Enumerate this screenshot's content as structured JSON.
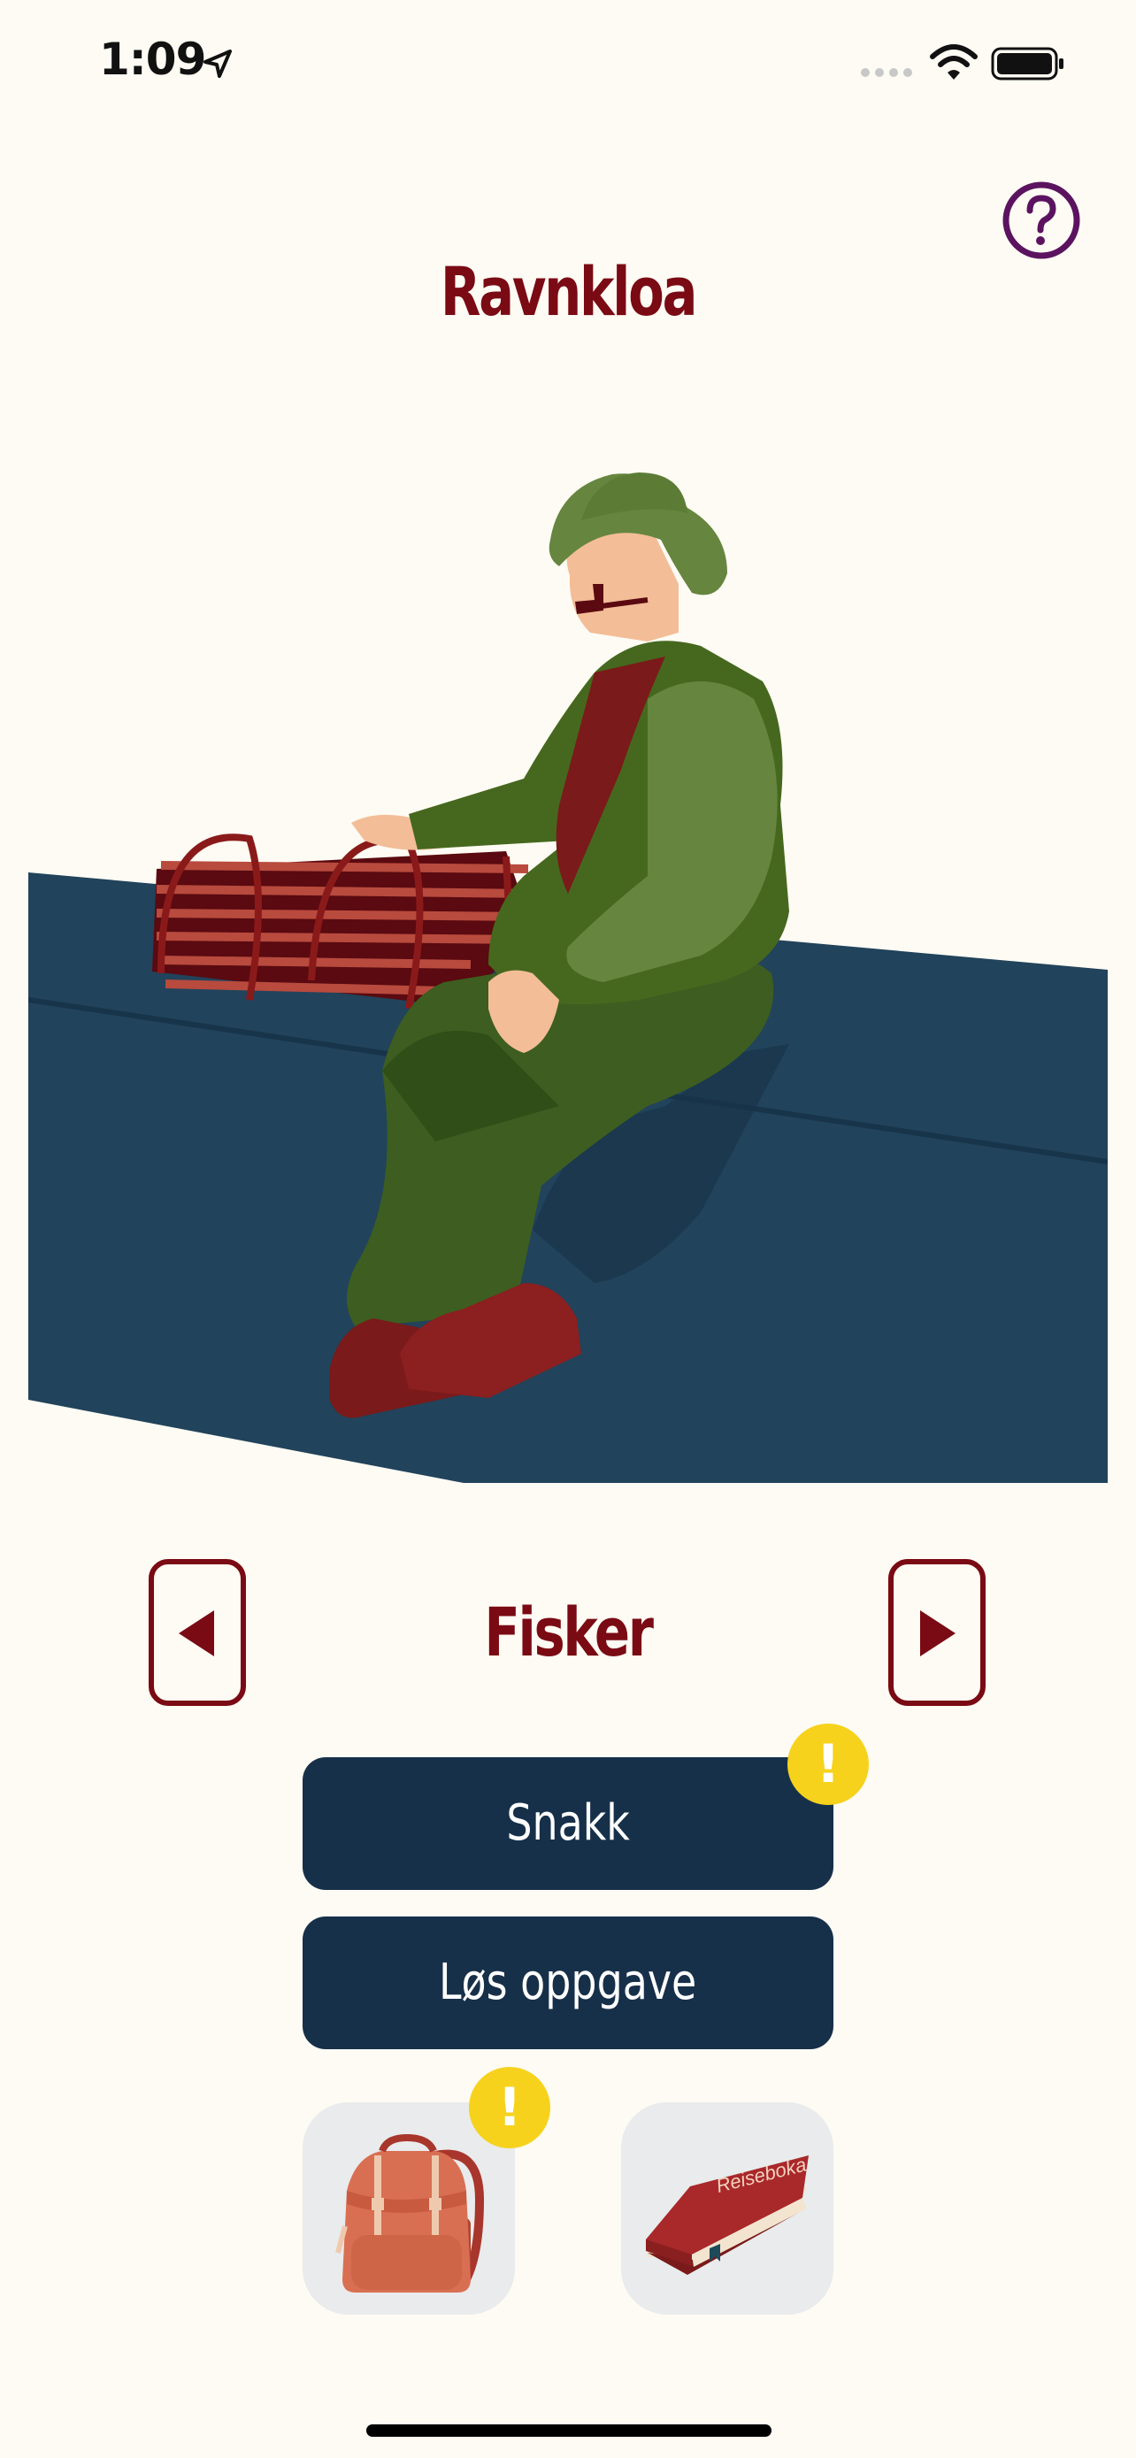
{
  "status_bar": {
    "time": "1:09"
  },
  "header": {
    "title": "Ravnkloa",
    "help_icon": "question-circle-icon"
  },
  "character": {
    "name": "Fisker"
  },
  "actions": {
    "talk_label": "Snakk",
    "task_label": "Løs oppgave"
  },
  "badges": {
    "talk": "!",
    "backpack": "!"
  },
  "inventory": {
    "book_title": "Reiseboka"
  },
  "colors": {
    "accent": "#7a0a14",
    "button": "#17304a",
    "badge": "#f6d21c",
    "background": "#fdfbf3",
    "help": "#5b1360"
  }
}
